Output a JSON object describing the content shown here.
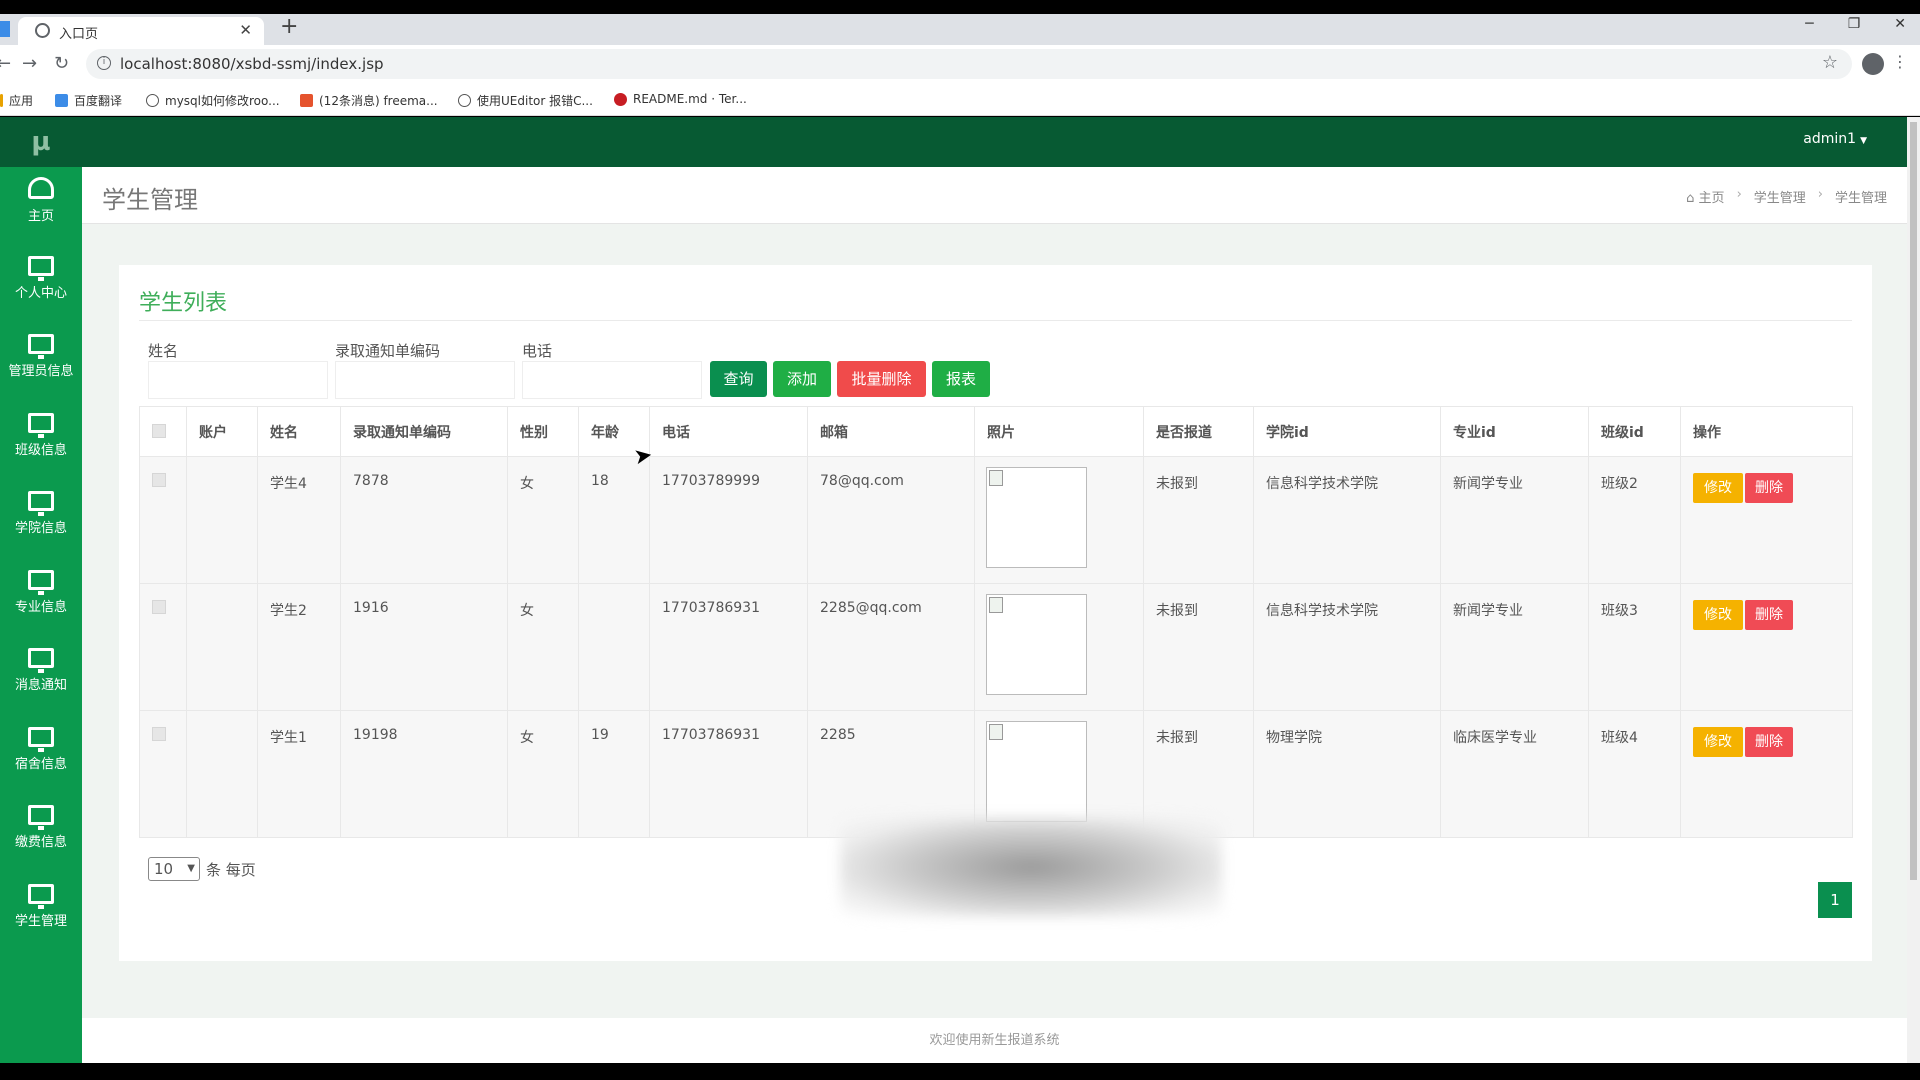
{
  "browser": {
    "tab_title": "入口页",
    "tab_close": "✕",
    "new_tab": "+",
    "url": "localhost:8080/xsbd-ssmj/index.jsp",
    "bookmarks": [
      "应用",
      "百度翻译",
      "mysql如何修改roo...",
      "(12条消息) freema...",
      "使用UEditor 报错C...",
      "README.md · Ter..."
    ]
  },
  "app": {
    "logo": "µ",
    "user": "admin1",
    "sidebar": [
      {
        "label": "主页",
        "icon": "dashboard-icon"
      },
      {
        "label": "个人中心",
        "icon": "monitor-icon"
      },
      {
        "label": "管理员信息",
        "icon": "monitor-icon"
      },
      {
        "label": "班级信息",
        "icon": "monitor-icon"
      },
      {
        "label": "学院信息",
        "icon": "monitor-icon"
      },
      {
        "label": "专业信息",
        "icon": "monitor-icon"
      },
      {
        "label": "消息通知",
        "icon": "monitor-icon"
      },
      {
        "label": "宿舍信息",
        "icon": "monitor-icon"
      },
      {
        "label": "缴费信息",
        "icon": "monitor-icon"
      },
      {
        "label": "学生管理",
        "icon": "monitor-icon"
      }
    ],
    "page_title": "学生管理",
    "breadcrumb": [
      "主页",
      "学生管理",
      "学生管理"
    ],
    "card_title": "学生列表",
    "filters": {
      "name_label": "姓名",
      "code_label": "录取通知单编码",
      "phone_label": "电话"
    },
    "buttons": {
      "query": "查询",
      "add": "添加",
      "batch_delete": "批量删除",
      "report": "报表"
    },
    "table": {
      "headers": [
        "账户",
        "姓名",
        "录取通知单编码",
        "性别",
        "年龄",
        "电话",
        "邮箱",
        "照片",
        "是否报道",
        "学院id",
        "专业id",
        "班级id",
        "操作"
      ],
      "rows": [
        {
          "account": "",
          "name": "学生4",
          "code": "7878",
          "gender": "女",
          "age": "18",
          "phone": "17703789999",
          "email": "78@qq.com",
          "reported": "未报到",
          "college": "信息科学技术学院",
          "major": "新闻学专业",
          "class": "班级2"
        },
        {
          "account": "",
          "name": "学生2",
          "code": "1916",
          "gender": "女",
          "age": "",
          "phone": "17703786931",
          "email": "2285@qq.com",
          "reported": "未报到",
          "college": "信息科学技术学院",
          "major": "新闻学专业",
          "class": "班级3"
        },
        {
          "account": "",
          "name": "学生1",
          "code": "19198",
          "gender": "女",
          "age": "19",
          "phone": "17703786931",
          "email": "2285",
          "reported": "未报到",
          "college": "物理学院",
          "major": "临床医学专业",
          "class": "班级4"
        }
      ],
      "edit_label": "修改",
      "delete_label": "删除"
    },
    "pagination": {
      "page_size": "10",
      "per_page_text": "条 每页",
      "current_page": "1"
    },
    "footer": "欢迎使用新生报道系统"
  },
  "colors": {
    "sidebar": "#0b9a4e",
    "topbar": "#075a33",
    "accent_green": "#1fae45",
    "danger": "#f04b4b",
    "warning": "#f5b200"
  }
}
